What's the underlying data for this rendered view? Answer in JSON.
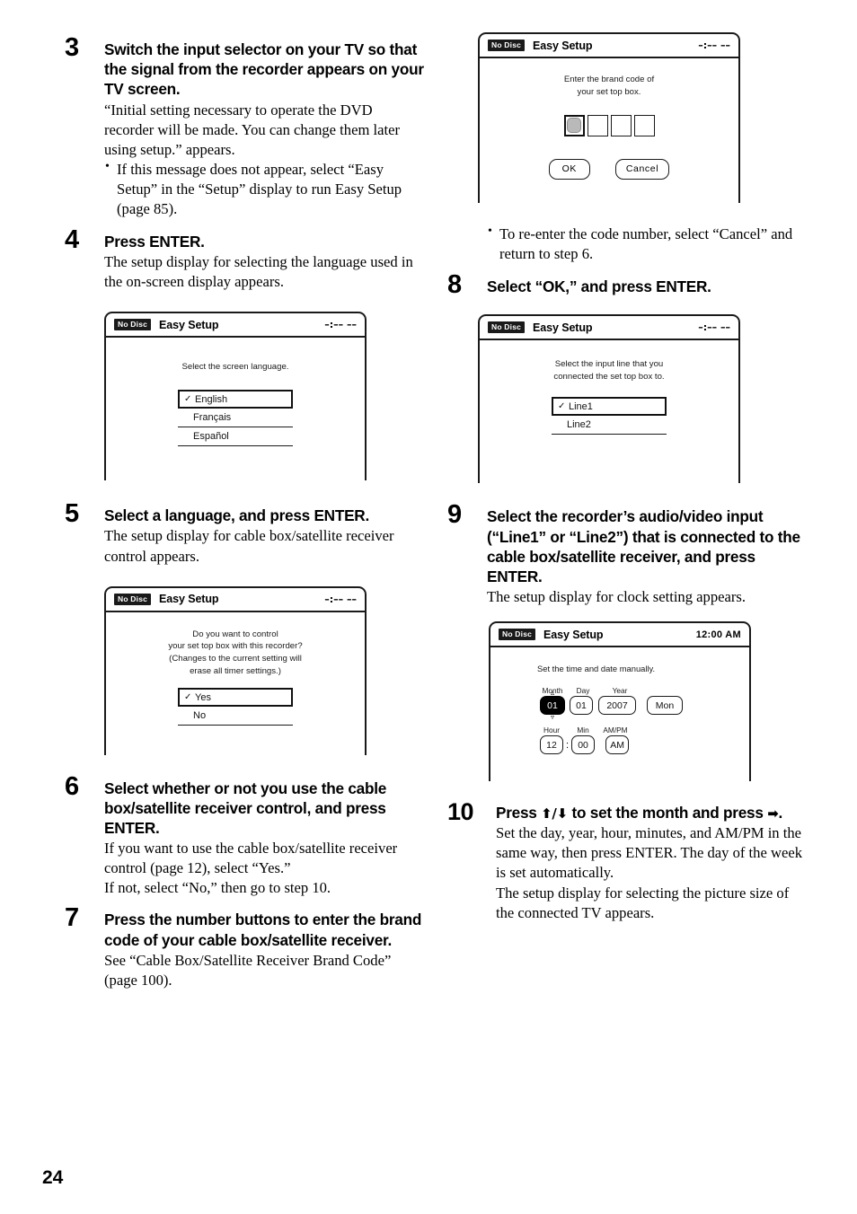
{
  "page": {
    "number": "24"
  },
  "left_column": {
    "steps": [
      {
        "num": "3",
        "title": "Switch the input selector on your TV so that the signal from the recorder appears on your TV screen.",
        "body": "“Initial setting necessary to operate the DVD recorder will be made. You can change them later using setup.” appears.",
        "bullet": "If this message does not appear, select “Easy Setup” in the “Setup” display to run Easy Setup (page 85)."
      },
      {
        "num": "4",
        "title": "Press ENTER.",
        "body": "The setup display for selecting the language used in the on-screen display appears."
      },
      {
        "num": "5",
        "title": "Select a language, and press ENTER.",
        "body": "The setup display for cable box/satellite receiver control appears."
      },
      {
        "num": "6",
        "title": "Select whether or not you use the cable box/satellite receiver control, and press ENTER.",
        "body_line1": "If you want to use the cable box/satellite receiver control (page 12), select “Yes.”",
        "body_line2": "If not, select “No,” then go to step 10."
      },
      {
        "num": "7",
        "title": "Press the number buttons to enter the brand code of your cable box/satellite receiver.",
        "body": "See “Cable Box/Satellite Receiver Brand Code” (page 100)."
      }
    ]
  },
  "right_column": {
    "bullet_recode": "To re-enter the code number, select “Cancel” and return to step 6.",
    "steps": [
      {
        "num": "8",
        "title": "Select “OK,” and press ENTER."
      },
      {
        "num": "9",
        "title": "Select the recorder’s audio/video input (“Line1” or “Line2”) that is connected to the cable box/satellite receiver, and press ENTER.",
        "body": "The setup display for clock setting appears."
      },
      {
        "num": "10",
        "title_pre": "Press ",
        "title_arrows": "⬆/⬇",
        "title_mid": " to set the month and press ",
        "title_arrow_right": "➡",
        "title_post": ".",
        "body_line1": "Set the day, year, hour, minutes, and AM/PM in the same way, then press ENTER. The day of the week is set automatically.",
        "body_line2": "The setup display for selecting the picture size of the connected TV appears."
      }
    ]
  },
  "figures": {
    "brand_code": {
      "badge": "No Disc",
      "title": "Easy Setup",
      "clock": "–:–– ––",
      "message_line1": "Enter the brand code of",
      "message_line2": "your set top box.",
      "code_boxes": [
        "",
        "",
        "",
        ""
      ],
      "ok_label": "OK",
      "cancel_label": "Cancel"
    },
    "language": {
      "badge": "No Disc",
      "title": "Easy Setup",
      "clock": "–:–– ––",
      "message_line1": "Select the screen language.",
      "items": [
        {
          "label": "English",
          "selected": true
        },
        {
          "label": "Français",
          "selected": false
        },
        {
          "label": "Español",
          "selected": false
        }
      ]
    },
    "input_line": {
      "badge": "No Disc",
      "title": "Easy Setup",
      "clock": "–:–– ––",
      "message_line1": "Select the input line that you",
      "message_line2": "connected the set top box to.",
      "items": [
        {
          "label": "Line1",
          "selected": true
        },
        {
          "label": "Line2",
          "selected": false
        }
      ]
    },
    "set_top_control": {
      "badge": "No Disc",
      "title": "Easy Setup",
      "clock": "–:–– ––",
      "message_line1": "Do you want to control",
      "message_line2": "your set top box with this recorder?",
      "message_line3": "(Changes to the current setting will",
      "message_line4": "erase all timer settings.)",
      "items": [
        {
          "label": "Yes",
          "selected": true
        },
        {
          "label": "No",
          "selected": false
        }
      ]
    },
    "clock_setting": {
      "badge": "No Disc",
      "title": "Easy Setup",
      "clock": "12:00 AM",
      "message": "Set the time and date manually.",
      "date_labels": [
        "Month",
        "Day",
        "Year"
      ],
      "date_values": [
        "01",
        "01",
        "2007",
        "Mon"
      ],
      "time_labels": [
        "Hour",
        "Min",
        "AM/PM"
      ],
      "time_values": [
        "12",
        "00",
        "AM"
      ]
    }
  },
  "icons": {
    "check": "✓"
  }
}
